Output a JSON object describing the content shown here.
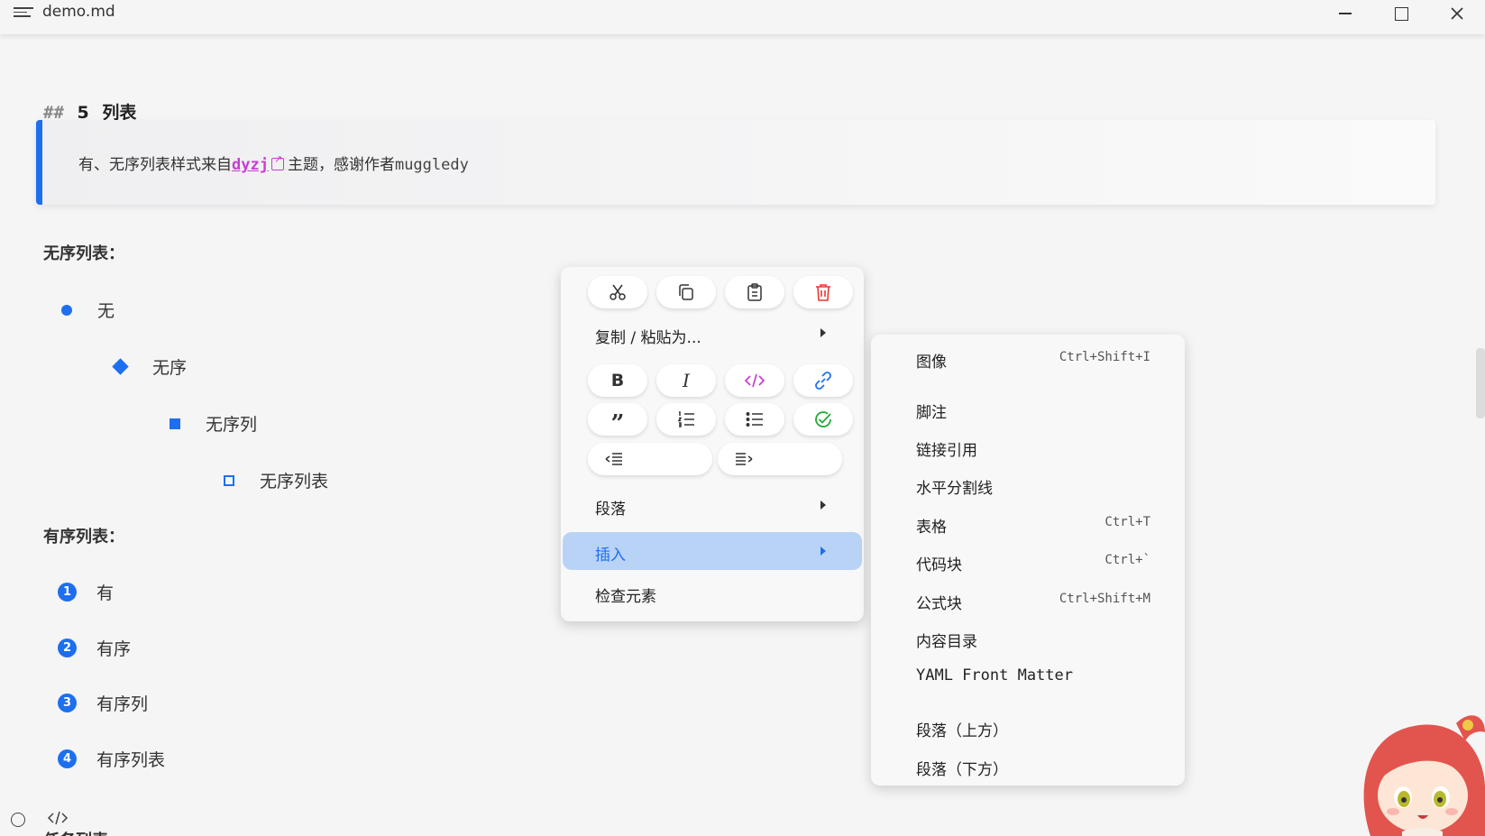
{
  "titlebar": {
    "title": "demo.md"
  },
  "doc": {
    "heading_hash": "##",
    "heading_number": "5",
    "heading_text": "列表",
    "quote": {
      "prefix": "有、无序列表样式来自",
      "link": "dyzj",
      "middle": "主题，感谢作者",
      "author": "muggledy"
    },
    "unordered_label": "无序列表：",
    "unordered_items": [
      "无",
      "无序",
      "无序列",
      "无序列表"
    ],
    "ordered_label": "有序列表：",
    "ordered_items": [
      {
        "num": "1",
        "text": "有"
      },
      {
        "num": "2",
        "text": "有序"
      },
      {
        "num": "3",
        "text": "有序列"
      },
      {
        "num": "4",
        "text": "有序列表"
      }
    ],
    "next_label_partial": "任务列表"
  },
  "context_menu": {
    "icon_rows": [
      [
        "cut",
        "copy",
        "paste",
        "delete"
      ],
      [
        "bold",
        "italic",
        "code",
        "link"
      ],
      [
        "quote",
        "ordered-list",
        "unordered-list",
        "task-list"
      ],
      [
        "outdent",
        "indent"
      ]
    ],
    "copy_paste_as": "复制 / 粘贴为...",
    "paragraph": "段落",
    "insert": "插入",
    "inspect": "检查元素",
    "colors": {
      "delete": "#e53935",
      "code": "#c83dd6",
      "link": "#1e6ff0",
      "check": "#22a83a",
      "active_bg": "#b9d3f6",
      "active_text": "#1e6ff0"
    }
  },
  "insert_submenu": {
    "items": [
      {
        "label": "图像",
        "shortcut": "Ctrl+Shift+I"
      },
      {
        "label": "脚注",
        "shortcut": ""
      },
      {
        "label": "链接引用",
        "shortcut": ""
      },
      {
        "label": "水平分割线",
        "shortcut": ""
      },
      {
        "label": "表格",
        "shortcut": "Ctrl+T"
      },
      {
        "label": "代码块",
        "shortcut": "Ctrl+`"
      },
      {
        "label": "公式块",
        "shortcut": "Ctrl+Shift+M"
      },
      {
        "label": "内容目录",
        "shortcut": ""
      },
      {
        "label": "YAML Front Matter",
        "shortcut": ""
      },
      {
        "label": "段落（上方）",
        "shortcut": ""
      },
      {
        "label": "段落（下方）",
        "shortcut": ""
      }
    ]
  },
  "status_bar": {
    "icons": [
      "outline-circle-icon",
      "source-code-icon"
    ]
  }
}
